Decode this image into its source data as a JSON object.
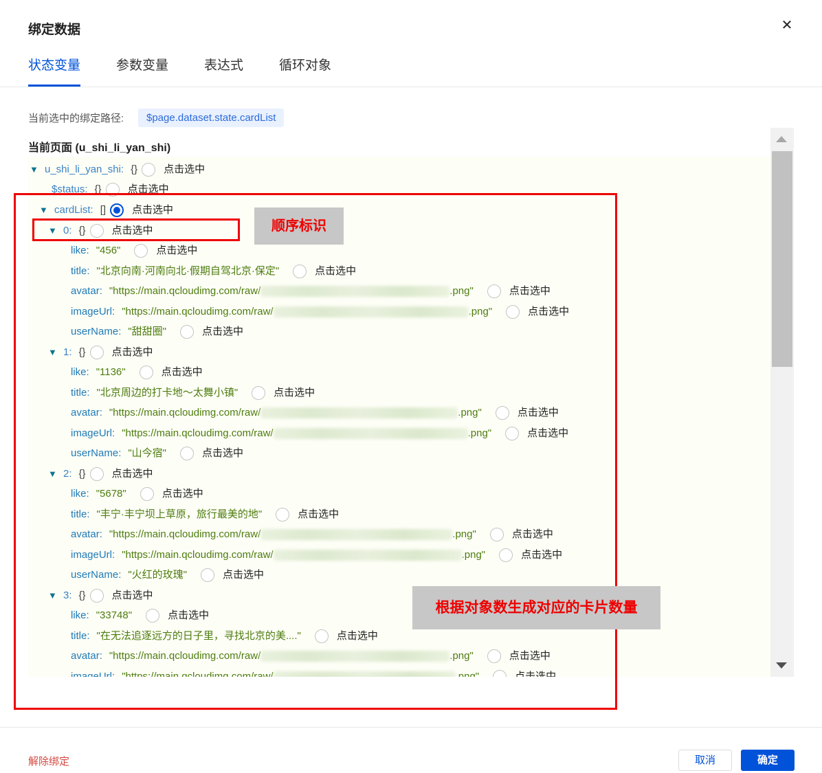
{
  "dialog": {
    "title": "绑定数据",
    "close_glyph": "✕"
  },
  "tabs": [
    "状态变量",
    "参数变量",
    "表达式",
    "循环对象"
  ],
  "path": {
    "label": "当前选中的绑定路径:",
    "value": "$page.dataset.state.cardList"
  },
  "page_section": "当前页面 (u_shi_li_yan_shi)",
  "select_label": "点击选中",
  "tree": {
    "root": {
      "key": "u_shi_li_yan_shi:",
      "brace": "{}"
    },
    "status": {
      "key": "$status:",
      "brace": "{}"
    },
    "cardList": {
      "key": "cardList:",
      "brace": "[]"
    },
    "url_prefix": "\"https://main.qcloudimg.com/raw/",
    "url_suffix": ".png\"",
    "items": [
      {
        "index": "0:",
        "brace": "{}",
        "like": "\"456\"",
        "title": "\"北京向南·河南向北·假期自驾北京·保定\"",
        "userName": "\"甜甜圈\""
      },
      {
        "index": "1:",
        "brace": "{}",
        "like": "\"1136\"",
        "title": "\"北京周边的打卡地～太舞小镇\"",
        "userName": "\"山今宿\""
      },
      {
        "index": "2:",
        "brace": "{}",
        "like": "\"5678\"",
        "title": "\"丰宁·丰宁坝上草原，旅行最美的地\"",
        "userName": "\"火红的玫瑰\""
      },
      {
        "index": "3:",
        "brace": "{}",
        "like": "\"33748\"",
        "title": "\"在无法追逐远方的日子里，寻找北京的美....\""
      }
    ],
    "field_keys": {
      "like": "like:",
      "title": "title:",
      "avatar": "avatar:",
      "imageUrl": "imageUrl:",
      "userName": "userName:"
    }
  },
  "annotations": {
    "order_label": "顺序标识",
    "cards_label": "根据对象数生成对应的卡片数量"
  },
  "footer": {
    "unbind": "解除绑定",
    "cancel": "取消",
    "confirm": "确定"
  },
  "colors": {
    "primary": "#0052d9",
    "danger": "#d54941",
    "annotation": "#ee0000"
  }
}
